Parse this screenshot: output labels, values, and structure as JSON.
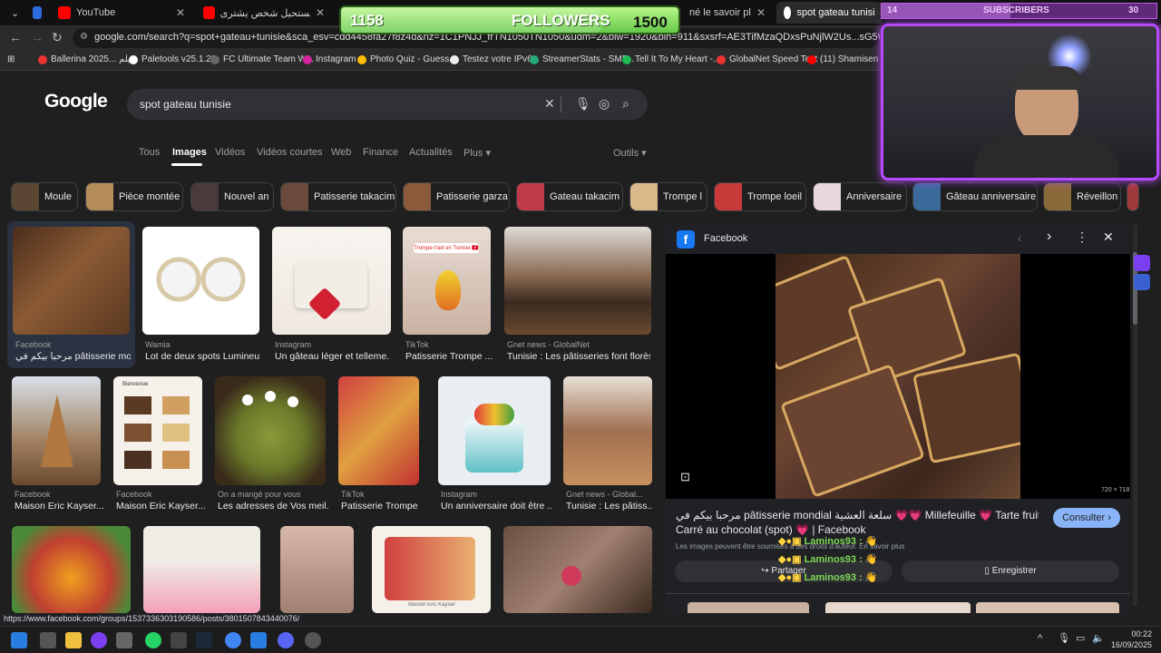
{
  "tabs": [
    {
      "label": ""
    },
    {
      "label": ""
    },
    {
      "label": "YouTube"
    },
    {
      "label": "مشروبات مستحيل شخص يشترى"
    },
    {
      "label": "né le savoir plus tôt"
    },
    {
      "label": "spot gateau tunisie - Recherc"
    }
  ],
  "address_bar": {
    "url": "google.com/search?q=spot+gateau+tunisie&sca_esv=cdd4458fa27f8z4d&rlz=1C1PNJJ_frTN1050TN1050&udm=2&biw=1920&bih=911&sxsrf=AE3TifMzaQDxsPuNjlW2Us...sG5WoXVkqvA%3A1757978547932"
  },
  "bookmarks": [
    "Ballerina 2025... فيلم",
    "Paletools v25.1.23",
    "FC Ultimate Team W...",
    "Instagram",
    "Photo Quiz - Guess...",
    "Testez votre IPv6.",
    "StreamerStats - SMF...",
    "Tell It To My Heart -...",
    "GlobalNet Speed Test",
    "(11) Shamisen ME"
  ],
  "google": {
    "logo": "Google",
    "query": "spot gateau tunisie",
    "tabs": [
      "Tous",
      "Images",
      "Vidéos",
      "Vidéos courtes",
      "Web",
      "Finance",
      "Actualités",
      "Plus ▾"
    ],
    "tools": "Outils ▾"
  },
  "chips": [
    "Moule",
    "Pièce montée",
    "Nouvel an",
    "Patisserie takacim",
    "Patisserie garza",
    "Gateau takacim",
    "Trompe l",
    "Trompe loeil",
    "Anniversaire",
    "Gâteau anniversaire",
    "Réveillon"
  ],
  "results": [
    {
      "source": "Facebook",
      "title": "مرحبا بيكم في pâtisserie mondi..."
    },
    {
      "source": "Wamia",
      "title": "Lot de deux spots Lumineu..."
    },
    {
      "source": "Instagram",
      "title": "Un gâteau léger et telleme..."
    },
    {
      "source": "TikTok",
      "title": "Patisserie Trompe ..."
    },
    {
      "source": "Gnet news - GlobalNet",
      "title": "Tunisie : Les pâtisseries font florès..."
    },
    {
      "source": "Facebook",
      "title": "Maison Eric Kayser..."
    },
    {
      "source": "Facebook",
      "title": "Maison Eric Kayser..."
    },
    {
      "source": "On a mangé pour vous",
      "title": "Les adresses de Vos meil..."
    },
    {
      "source": "TikTok",
      "title": "Patisserie Trompe ..."
    },
    {
      "source": "Instagram",
      "title": "Un anniversaire doit être ..."
    },
    {
      "source": "Gnet news - Global...",
      "title": "Tunisie : Les pâtiss..."
    }
  ],
  "tile_texts": {
    "tiktok_sticker": "Trompe-l'œil en Tunisie 🇹🇳",
    "card_line1": "Bienvenue",
    "card_line2": "Maison Eric Kayser"
  },
  "preview": {
    "source": "Facebook",
    "title_line1": "مرحبا بيكم في pâtisserie mondial سلعة العشية 💗💗 Millefeuille 💗 Tarte fruits 💗",
    "title_line2": "Carré au chocolat (spot) 💗 | Facebook",
    "dimensions": "720 × 718",
    "notice": "Les images peuvent être soumises à des droits d'auteur. En savoir plus",
    "visit_label": "Consulter ›",
    "share_label": "Partager",
    "save_label": "Enregistrer"
  },
  "chat_overlay": [
    {
      "user": "Laminos93 :",
      "text": "👋"
    },
    {
      "user": "Laminos93 :",
      "text": "👋"
    },
    {
      "user": "Laminos93 :",
      "text": "👋"
    }
  ],
  "stream_overlay": {
    "followers_count": "1158",
    "followers_label": "FOLLOWERS",
    "followers_goal": "1500",
    "subs_count": "14",
    "subs_label": "SUBSCRIBERS",
    "subs_goal": "30",
    "followers_progress": 0.77,
    "subs_progress": 0.47
  },
  "status_url": "https://www.facebook.com/groups/1537336303190586/posts/3801507843440076/",
  "clock": {
    "time": "00:22",
    "date": "16/09/2025"
  },
  "colors": {
    "accent_blue": "#8ab4f8",
    "panel_bg": "#202124",
    "page_bg": "#1f1f1f",
    "overlay_purple": "#b84bff",
    "followers_green": "#7ed957"
  }
}
